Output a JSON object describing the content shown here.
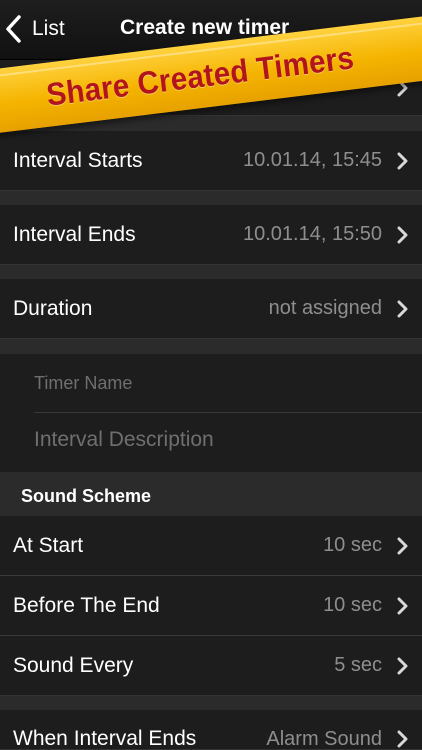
{
  "nav": {
    "back_label": "List",
    "title": "Create new timer"
  },
  "banner": {
    "text": "Share Created Timers",
    "color": "#f5b400",
    "text_color": "#b2141e"
  },
  "rows": {
    "interval_starts": {
      "label": "Interval Starts",
      "value": "10.01.14, 15:45"
    },
    "interval_ends": {
      "label": "Interval Ends",
      "value": "10.01.14, 15:50"
    },
    "duration": {
      "label": "Duration",
      "value": "not assigned"
    }
  },
  "fields": {
    "timer_name_placeholder": "Timer Name",
    "interval_description_placeholder": "Interval Description"
  },
  "sound_scheme": {
    "title": "Sound Scheme",
    "at_start": {
      "label": "At Start",
      "value": "10 sec"
    },
    "before_end": {
      "label": "Before The End",
      "value": "10 sec"
    },
    "sound_every": {
      "label": "Sound Every",
      "value": "5 sec"
    }
  },
  "when_ends": {
    "label": "When Interval Ends",
    "value": "Alarm Sound"
  },
  "icons": {
    "back": "chevron-left-icon",
    "disclosure": "chevron-right-icon"
  }
}
